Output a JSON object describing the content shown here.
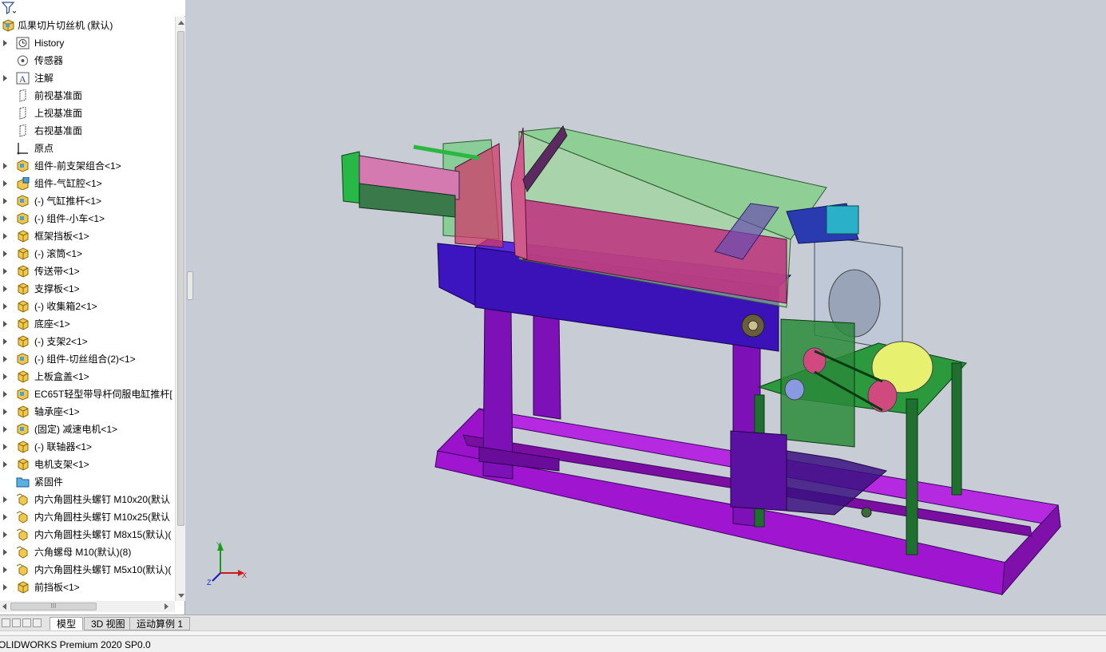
{
  "tree": {
    "root_label": "瓜果切片切丝机 (默认)",
    "items": [
      {
        "label": "History",
        "icon": "history-icon",
        "expand": true
      },
      {
        "label": "传感器",
        "icon": "sensor-icon",
        "expand": false
      },
      {
        "label": "注解",
        "icon": "annotation-icon",
        "expand": true
      },
      {
        "label": "前视基准面",
        "icon": "plane-icon",
        "expand": false
      },
      {
        "label": "上视基准面",
        "icon": "plane-icon",
        "expand": false
      },
      {
        "label": "右视基准面",
        "icon": "plane-icon",
        "expand": false
      },
      {
        "label": "原点",
        "icon": "origin-icon",
        "expand": false
      },
      {
        "label": "组件-前支架组合<1>",
        "icon": "assembly-icon",
        "expand": true
      },
      {
        "label": "组件-气缸腔<1>",
        "icon": "assembly-edit-icon",
        "expand": true
      },
      {
        "label": "(-) 气缸推杆<1>",
        "icon": "assembly-icon",
        "expand": true
      },
      {
        "label": "(-) 组件-小车<1>",
        "icon": "assembly-icon",
        "expand": true
      },
      {
        "label": "框架挡板<1>",
        "icon": "part-icon",
        "expand": true
      },
      {
        "label": "(-) 滚筒<1>",
        "icon": "part-icon",
        "expand": true
      },
      {
        "label": "传送带<1>",
        "icon": "part-icon",
        "expand": true
      },
      {
        "label": "支撑板<1>",
        "icon": "part-icon",
        "expand": true
      },
      {
        "label": "(-) 收集箱2<1>",
        "icon": "part-icon",
        "expand": true
      },
      {
        "label": "底座<1>",
        "icon": "part-icon",
        "expand": true
      },
      {
        "label": "(-) 支架2<1>",
        "icon": "part-icon",
        "expand": true
      },
      {
        "label": "(-) 组件-切丝组合(2)<1>",
        "icon": "assembly-icon",
        "expand": true
      },
      {
        "label": "上板盒盖<1>",
        "icon": "part-icon",
        "expand": true
      },
      {
        "label": "EC65T轻型带导杆伺服电缸推杆[",
        "icon": "assembly-icon",
        "expand": true
      },
      {
        "label": "轴承座<1>",
        "icon": "part-icon",
        "expand": true
      },
      {
        "label": "(固定) 减速电机<1>",
        "icon": "assembly-icon",
        "expand": true
      },
      {
        "label": "(-) 联轴器<1>",
        "icon": "part-icon",
        "expand": true
      },
      {
        "label": "电机支架<1>",
        "icon": "part-icon",
        "expand": true
      },
      {
        "label": "紧固件",
        "icon": "folder-icon",
        "expand": false
      },
      {
        "label": "内六角圆柱头螺钉 M10x20(默认",
        "icon": "pattern-icon",
        "expand": true
      },
      {
        "label": "内六角圆柱头螺钉 M10x25(默认",
        "icon": "pattern-icon",
        "expand": true
      },
      {
        "label": "内六角圆柱头螺钉 M8x15(默认)(",
        "icon": "pattern-icon",
        "expand": true
      },
      {
        "label": "六角螺母 M10(默认)(8)",
        "icon": "pattern-icon",
        "expand": true
      },
      {
        "label": "内六角圆柱头螺钉 M5x10(默认)(",
        "icon": "pattern-icon",
        "expand": true
      },
      {
        "label": "前挡板<1>",
        "icon": "part-icon",
        "expand": true
      }
    ]
  },
  "tabs": [
    {
      "label": "模型",
      "active": true
    },
    {
      "label": "3D 视图",
      "active": false
    },
    {
      "label": "运动算例 1",
      "active": false
    }
  ],
  "status": {
    "text": "OLIDWORKS Premium 2020 SP0.0"
  },
  "triad": {
    "x": "X",
    "y": "Y",
    "z": "Z"
  },
  "colors": {
    "frame_purple": "#8a18c8",
    "body_blue": "#3a10b8",
    "hopper_green": "#66d07a",
    "belt_magenta": "#b01e8c",
    "motor_stand_green": "#1d6b26",
    "viewport_bg": "#c8ccd4"
  }
}
